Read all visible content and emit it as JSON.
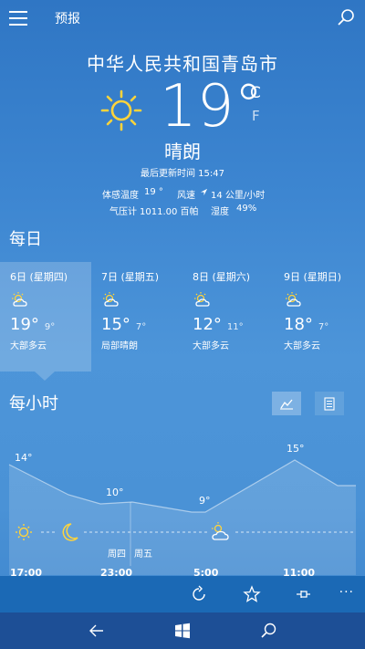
{
  "topbar": {
    "title": "预报"
  },
  "current": {
    "city": "中华人民共和国青岛市",
    "temp": "19°",
    "unit_c": "C",
    "unit_f": "F",
    "condition": "晴朗",
    "updated": "最后更新时间 15:47",
    "feels_label": "体感温度",
    "feels_value": "19 °",
    "wind_label": "风速",
    "wind_value": "14 公里/小时",
    "pressure_label": "气压计",
    "pressure_value": "1011.00 百帕",
    "humidity_label": "湿度",
    "humidity_value": "49%"
  },
  "daily": {
    "title": "每日",
    "days": [
      {
        "date": "6日 (星期四)",
        "hi": "19°",
        "lo": "9°",
        "desc": "大部多云",
        "icon": "partly-sunny-icon"
      },
      {
        "date": "7日 (星期五)",
        "hi": "15°",
        "lo": "7°",
        "desc": "局部晴朗",
        "icon": "partly-sunny-icon"
      },
      {
        "date": "8日 (星期六)",
        "hi": "12°",
        "lo": "11°",
        "desc": "大部多云",
        "icon": "partly-sunny-icon"
      },
      {
        "date": "9日 (星期日)",
        "hi": "18°",
        "lo": "7°",
        "desc": "大部多云",
        "icon": "partly-sunny-icon"
      }
    ]
  },
  "hourly": {
    "title": "每小时",
    "temps": [
      {
        "label": "14°",
        "value": 14
      },
      {
        "label": "10°",
        "value": 10
      },
      {
        "label": "9°",
        "value": 9
      },
      {
        "label": "15°",
        "value": 15
      }
    ],
    "day_labels": [
      "周四",
      "周五"
    ],
    "times": [
      "17:00",
      "23:00",
      "5:00",
      "11:00"
    ]
  },
  "colors": {
    "appbar": "#1b69b5",
    "navbar": "#1d4f96",
    "sun": "#ffd43b"
  }
}
